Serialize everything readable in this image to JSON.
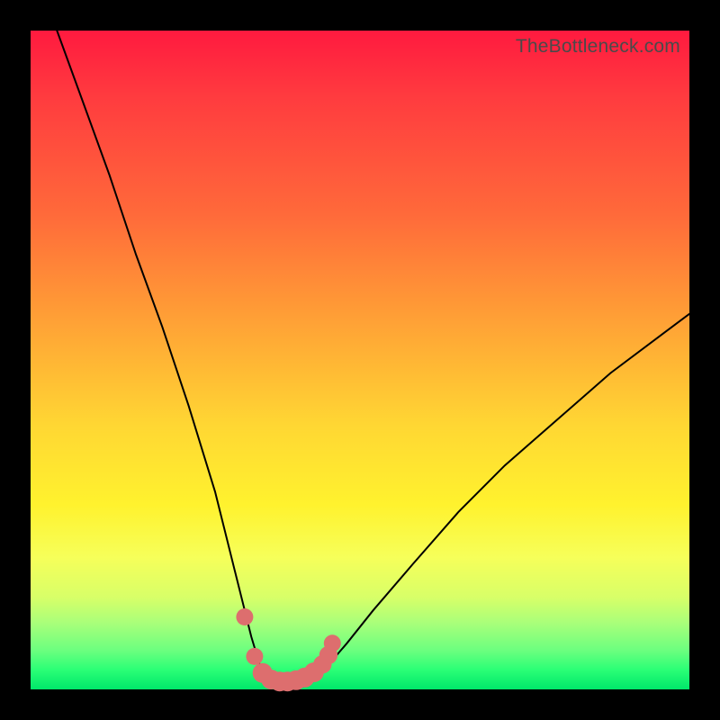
{
  "attribution": "TheBottleneck.com",
  "colors": {
    "frame_bg": "#000000",
    "gradient_top": "#ff1a3f",
    "gradient_bottom": "#00e66a",
    "curve_stroke": "#000000",
    "marker_fill": "#dd6e6e"
  },
  "chart_data": {
    "type": "line",
    "title": "",
    "xlabel": "",
    "ylabel": "",
    "x_range": [
      0,
      100
    ],
    "y_range": [
      0,
      100
    ],
    "curve": {
      "description": "bottleneck penalty curve; value ~100 at x=0, drops steeply to ~0 near x≈38, rises back toward ~55 at x=100",
      "points": [
        {
          "x": 4,
          "y": 100
        },
        {
          "x": 8,
          "y": 89
        },
        {
          "x": 12,
          "y": 78
        },
        {
          "x": 16,
          "y": 66
        },
        {
          "x": 20,
          "y": 55
        },
        {
          "x": 24,
          "y": 43
        },
        {
          "x": 28,
          "y": 30
        },
        {
          "x": 31,
          "y": 18
        },
        {
          "x": 33.5,
          "y": 8
        },
        {
          "x": 35,
          "y": 3
        },
        {
          "x": 37,
          "y": 1.2
        },
        {
          "x": 39,
          "y": 1.0
        },
        {
          "x": 41,
          "y": 1.2
        },
        {
          "x": 43,
          "y": 2.0
        },
        {
          "x": 45,
          "y": 3.5
        },
        {
          "x": 48,
          "y": 7
        },
        {
          "x": 52,
          "y": 12
        },
        {
          "x": 58,
          "y": 19
        },
        {
          "x": 65,
          "y": 27
        },
        {
          "x": 72,
          "y": 34
        },
        {
          "x": 80,
          "y": 41
        },
        {
          "x": 88,
          "y": 48
        },
        {
          "x": 96,
          "y": 54
        },
        {
          "x": 100,
          "y": 57
        }
      ]
    },
    "markers": [
      {
        "x": 32.5,
        "y": 11,
        "r": 1.3
      },
      {
        "x": 34.0,
        "y": 5,
        "r": 1.3
      },
      {
        "x": 35.2,
        "y": 2.5,
        "r": 1.5
      },
      {
        "x": 36.5,
        "y": 1.5,
        "r": 1.5
      },
      {
        "x": 37.8,
        "y": 1.2,
        "r": 1.5
      },
      {
        "x": 39.0,
        "y": 1.2,
        "r": 1.5
      },
      {
        "x": 40.3,
        "y": 1.4,
        "r": 1.5
      },
      {
        "x": 41.6,
        "y": 1.8,
        "r": 1.5
      },
      {
        "x": 43.0,
        "y": 2.6,
        "r": 1.5
      },
      {
        "x": 44.3,
        "y": 3.8,
        "r": 1.4
      },
      {
        "x": 45.2,
        "y": 5.2,
        "r": 1.4
      },
      {
        "x": 45.8,
        "y": 7.0,
        "r": 1.3
      }
    ]
  }
}
